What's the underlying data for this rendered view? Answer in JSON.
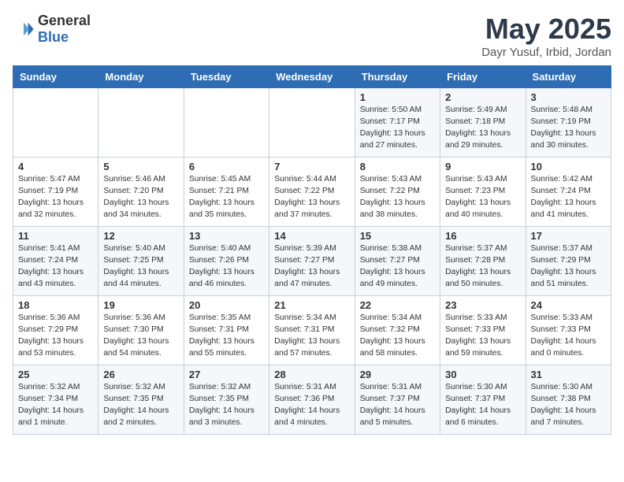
{
  "header": {
    "logo_general": "General",
    "logo_blue": "Blue",
    "month_title": "May 2025",
    "location": "Dayr Yusuf, Irbid, Jordan"
  },
  "weekdays": [
    "Sunday",
    "Monday",
    "Tuesday",
    "Wednesday",
    "Thursday",
    "Friday",
    "Saturday"
  ],
  "weeks": [
    [
      {
        "day": "",
        "info": ""
      },
      {
        "day": "",
        "info": ""
      },
      {
        "day": "",
        "info": ""
      },
      {
        "day": "",
        "info": ""
      },
      {
        "day": "1",
        "info": "Sunrise: 5:50 AM\nSunset: 7:17 PM\nDaylight: 13 hours and 27 minutes."
      },
      {
        "day": "2",
        "info": "Sunrise: 5:49 AM\nSunset: 7:18 PM\nDaylight: 13 hours and 29 minutes."
      },
      {
        "day": "3",
        "info": "Sunrise: 5:48 AM\nSunset: 7:19 PM\nDaylight: 13 hours and 30 minutes."
      }
    ],
    [
      {
        "day": "4",
        "info": "Sunrise: 5:47 AM\nSunset: 7:19 PM\nDaylight: 13 hours and 32 minutes."
      },
      {
        "day": "5",
        "info": "Sunrise: 5:46 AM\nSunset: 7:20 PM\nDaylight: 13 hours and 34 minutes."
      },
      {
        "day": "6",
        "info": "Sunrise: 5:45 AM\nSunset: 7:21 PM\nDaylight: 13 hours and 35 minutes."
      },
      {
        "day": "7",
        "info": "Sunrise: 5:44 AM\nSunset: 7:22 PM\nDaylight: 13 hours and 37 minutes."
      },
      {
        "day": "8",
        "info": "Sunrise: 5:43 AM\nSunset: 7:22 PM\nDaylight: 13 hours and 38 minutes."
      },
      {
        "day": "9",
        "info": "Sunrise: 5:43 AM\nSunset: 7:23 PM\nDaylight: 13 hours and 40 minutes."
      },
      {
        "day": "10",
        "info": "Sunrise: 5:42 AM\nSunset: 7:24 PM\nDaylight: 13 hours and 41 minutes."
      }
    ],
    [
      {
        "day": "11",
        "info": "Sunrise: 5:41 AM\nSunset: 7:24 PM\nDaylight: 13 hours and 43 minutes."
      },
      {
        "day": "12",
        "info": "Sunrise: 5:40 AM\nSunset: 7:25 PM\nDaylight: 13 hours and 44 minutes."
      },
      {
        "day": "13",
        "info": "Sunrise: 5:40 AM\nSunset: 7:26 PM\nDaylight: 13 hours and 46 minutes."
      },
      {
        "day": "14",
        "info": "Sunrise: 5:39 AM\nSunset: 7:27 PM\nDaylight: 13 hours and 47 minutes."
      },
      {
        "day": "15",
        "info": "Sunrise: 5:38 AM\nSunset: 7:27 PM\nDaylight: 13 hours and 49 minutes."
      },
      {
        "day": "16",
        "info": "Sunrise: 5:37 AM\nSunset: 7:28 PM\nDaylight: 13 hours and 50 minutes."
      },
      {
        "day": "17",
        "info": "Sunrise: 5:37 AM\nSunset: 7:29 PM\nDaylight: 13 hours and 51 minutes."
      }
    ],
    [
      {
        "day": "18",
        "info": "Sunrise: 5:36 AM\nSunset: 7:29 PM\nDaylight: 13 hours and 53 minutes."
      },
      {
        "day": "19",
        "info": "Sunrise: 5:36 AM\nSunset: 7:30 PM\nDaylight: 13 hours and 54 minutes."
      },
      {
        "day": "20",
        "info": "Sunrise: 5:35 AM\nSunset: 7:31 PM\nDaylight: 13 hours and 55 minutes."
      },
      {
        "day": "21",
        "info": "Sunrise: 5:34 AM\nSunset: 7:31 PM\nDaylight: 13 hours and 57 minutes."
      },
      {
        "day": "22",
        "info": "Sunrise: 5:34 AM\nSunset: 7:32 PM\nDaylight: 13 hours and 58 minutes."
      },
      {
        "day": "23",
        "info": "Sunrise: 5:33 AM\nSunset: 7:33 PM\nDaylight: 13 hours and 59 minutes."
      },
      {
        "day": "24",
        "info": "Sunrise: 5:33 AM\nSunset: 7:33 PM\nDaylight: 14 hours and 0 minutes."
      }
    ],
    [
      {
        "day": "25",
        "info": "Sunrise: 5:32 AM\nSunset: 7:34 PM\nDaylight: 14 hours and 1 minute."
      },
      {
        "day": "26",
        "info": "Sunrise: 5:32 AM\nSunset: 7:35 PM\nDaylight: 14 hours and 2 minutes."
      },
      {
        "day": "27",
        "info": "Sunrise: 5:32 AM\nSunset: 7:35 PM\nDaylight: 14 hours and 3 minutes."
      },
      {
        "day": "28",
        "info": "Sunrise: 5:31 AM\nSunset: 7:36 PM\nDaylight: 14 hours and 4 minutes."
      },
      {
        "day": "29",
        "info": "Sunrise: 5:31 AM\nSunset: 7:37 PM\nDaylight: 14 hours and 5 minutes."
      },
      {
        "day": "30",
        "info": "Sunrise: 5:30 AM\nSunset: 7:37 PM\nDaylight: 14 hours and 6 minutes."
      },
      {
        "day": "31",
        "info": "Sunrise: 5:30 AM\nSunset: 7:38 PM\nDaylight: 14 hours and 7 minutes."
      }
    ]
  ]
}
